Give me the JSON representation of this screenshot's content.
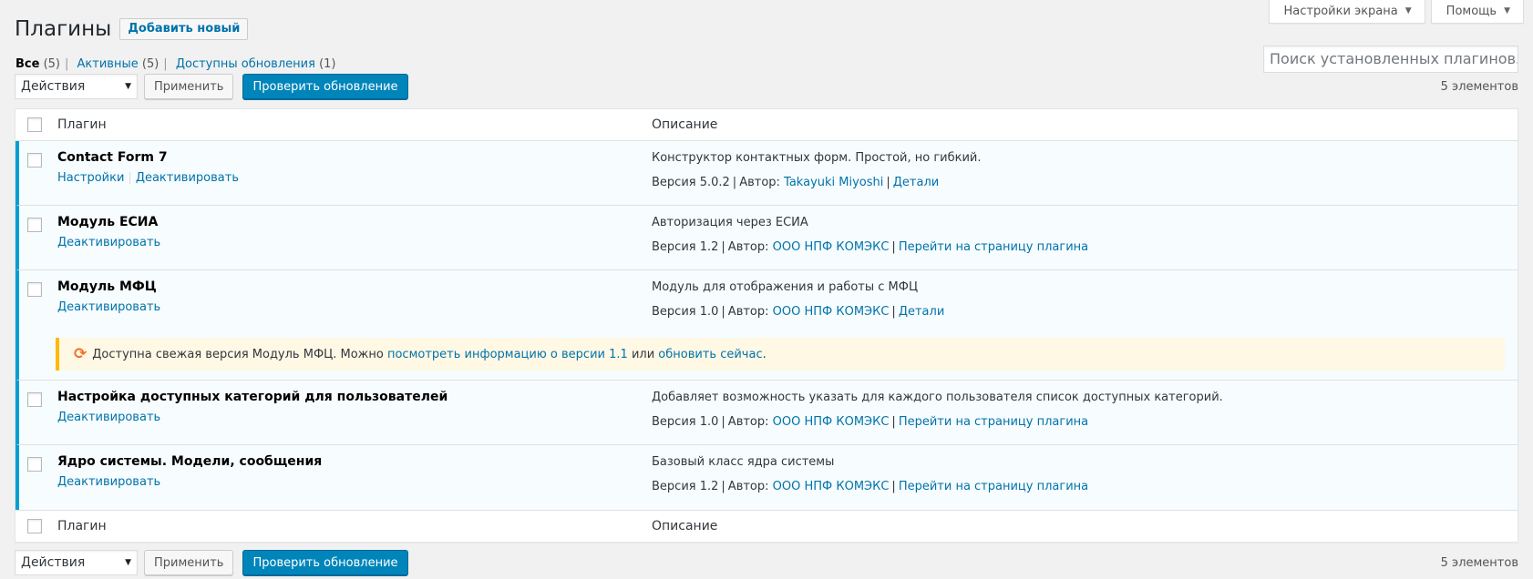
{
  "screen_meta": {
    "screen_options_label": "Настройки экрана",
    "help_label": "Помощь"
  },
  "header": {
    "title": "Плагины",
    "add_new_label": "Добавить новый"
  },
  "filters": {
    "all_label": "Все",
    "all_count": "(5)",
    "active_label": "Активные",
    "active_count": "(5)",
    "updates_label": "Доступны обновления",
    "updates_count": "(1)"
  },
  "search": {
    "placeholder": "Поиск установленных плагинов..."
  },
  "bulk": {
    "actions_label": "Действия",
    "apply_label": "Применить",
    "check_updates_label": "Проверить обновление",
    "items_count": "5 элементов"
  },
  "table": {
    "col_plugin": "Плагин",
    "col_description": "Описание",
    "author_prefix": "Автор:",
    "rows": [
      {
        "name": "Contact Form 7",
        "action1": "Настройки",
        "action2": "Деактивировать",
        "description": "Конструктор контактных форм. Простой, но гибкий.",
        "version": "Версия 5.0.2",
        "author": "Takayuki Miyoshi",
        "link": "Детали"
      },
      {
        "name": "Модуль ЕСИА",
        "action1": "Деактивировать",
        "description": "Авторизация через ЕСИА",
        "version": "Версия 1.2",
        "author": "ООО НПФ КОМЭКС",
        "link": "Перейти на страницу плагина"
      },
      {
        "name": "Модуль МФЦ",
        "action1": "Деактивировать",
        "description": "Модуль для отображения и работы с МФЦ",
        "version": "Версия 1.0",
        "author": "ООО НПФ КОМЭКС",
        "link": "Детали"
      },
      {
        "name": "Настройка доступных категорий для пользователей",
        "action1": "Деактивировать",
        "description": "Добавляет возможность указать для каждого пользователя список доступных категорий.",
        "version": "Версия 1.0",
        "author": "ООО НПФ КОМЭКС",
        "link": "Перейти на страницу плагина"
      },
      {
        "name": "Ядро системы. Модели, сообщения",
        "action1": "Деактивировать",
        "description": "Базовый класс ядра системы",
        "version": "Версия 1.2",
        "author": "ООО НПФ КОМЭКС",
        "link": "Перейти на страницу плагина"
      }
    ],
    "update_notice": {
      "text_before": "Доступна свежая версия Модуль МФЦ. Можно",
      "view_link": "посмотреть информацию о версии 1.1",
      "middle": "или",
      "update_link": "обновить сейчас",
      "end": "."
    }
  },
  "colors": {
    "accent": "#0073aa",
    "primary_button": "#0085ba",
    "active_row_border": "#00a0d2",
    "notice_border": "#ffb900",
    "notice_bg": "#fff8e5",
    "update_icon": "#f56e28"
  }
}
